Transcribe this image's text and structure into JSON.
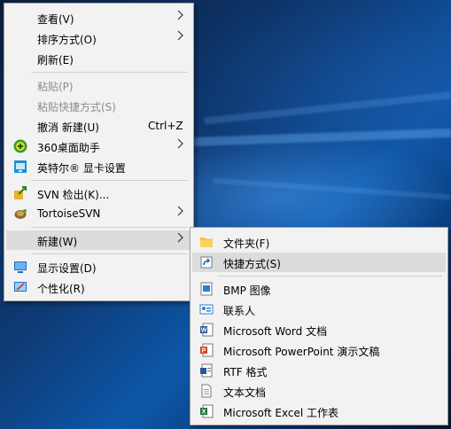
{
  "context_menu": {
    "items": [
      {
        "label": "查看(V)"
      },
      {
        "label": "排序方式(O)"
      },
      {
        "label": "刷新(E)"
      },
      {
        "label": "粘贴(P)"
      },
      {
        "label": "粘贴快捷方式(S)"
      },
      {
        "label": "撤消 新建(U)",
        "shortcut": "Ctrl+Z"
      },
      {
        "label": "360桌面助手"
      },
      {
        "label": "英特尔® 显卡设置"
      },
      {
        "label": "SVN 检出(K)..."
      },
      {
        "label": "TortoiseSVN"
      },
      {
        "label": "新建(W)"
      },
      {
        "label": "显示设置(D)"
      },
      {
        "label": "个性化(R)"
      }
    ],
    "submenu_arrow": ">"
  },
  "new_submenu": {
    "items": [
      {
        "label": "文件夹(F)"
      },
      {
        "label": "快捷方式(S)"
      },
      {
        "label": "BMP 图像"
      },
      {
        "label": "联系人"
      },
      {
        "label": "Microsoft Word 文档"
      },
      {
        "label": "Microsoft PowerPoint 演示文稿"
      },
      {
        "label": "RTF 格式"
      },
      {
        "label": "文本文档"
      },
      {
        "label": "Microsoft Excel 工作表"
      }
    ]
  },
  "icons": {
    "360": "360-assistant-icon",
    "intel": "intel-graphics-icon",
    "svn_checkout": "svn-checkout-icon",
    "tortoise": "tortoisesvn-icon",
    "display": "display-settings-icon",
    "personalize": "personalize-icon",
    "folder": "folder-icon",
    "shortcut": "shortcut-icon",
    "bmp": "bmp-image-icon",
    "contact": "contact-icon",
    "word": "word-document-icon",
    "ppt": "powerpoint-icon",
    "rtf": "rtf-document-icon",
    "txt": "text-document-icon",
    "excel": "excel-icon"
  },
  "colors": {
    "menu_bg": "#f2f2f2",
    "highlight": "#dcdcdc",
    "disabled_text": "#8d8d8d"
  }
}
